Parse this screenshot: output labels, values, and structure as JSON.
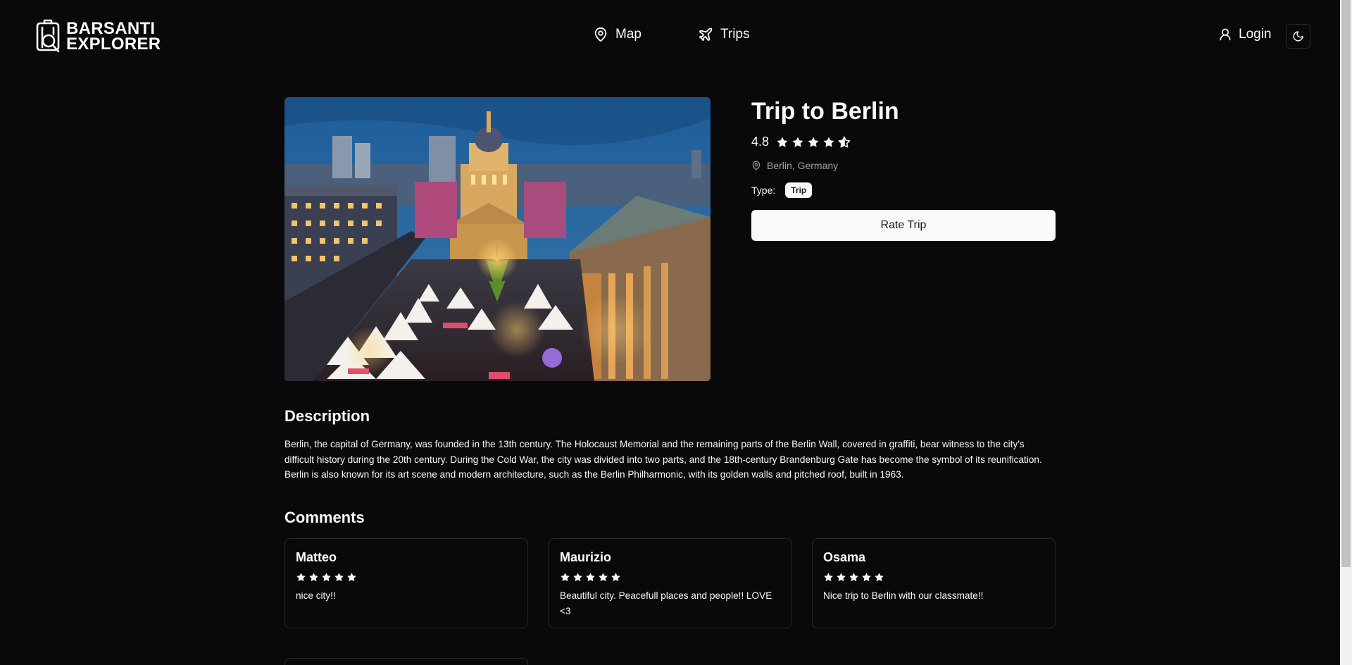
{
  "header": {
    "logo_line1": "BARSANTI",
    "logo_line2": "EXPLORER",
    "nav": [
      {
        "label": "Map",
        "icon": "map-pin-icon"
      },
      {
        "label": "Trips",
        "icon": "plane-icon"
      }
    ],
    "login_label": "Login",
    "theme_icon": "moon-icon"
  },
  "trip": {
    "title": "Trip to Berlin",
    "rating": "4.8",
    "rating_value": 4.8,
    "location": "Berlin, Germany",
    "type_label": "Type:",
    "type_value": "Trip",
    "rate_button": "Rate Trip",
    "image_alt": "Berlin Christmas market at Gendarmenmarkt"
  },
  "description": {
    "heading": "Description",
    "text": "Berlin, the capital of Germany, was founded in the 13th century. The Holocaust Memorial and the remaining parts of the Berlin Wall, covered in graffiti, bear witness to the city's difficult history during the 20th century. During the Cold War, the city was divided into two parts, and the 18th-century Brandenburg Gate has become the symbol of its reunification. Berlin is also known for its art scene and modern architecture, such as the Berlin Philharmonic, with its golden walls and pitched roof, built in 1963."
  },
  "comments": {
    "heading": "Comments",
    "items": [
      {
        "name": "Matteo",
        "stars": 5,
        "text": "nice city!!"
      },
      {
        "name": "Maurizio",
        "stars": 5,
        "text": "Beautiful city. Peacefull places and people!! LOVE <3"
      },
      {
        "name": "Osama",
        "stars": 5,
        "text": "Nice trip to Berlin with our classmate!!"
      }
    ]
  },
  "colors": {
    "background": "#09090b",
    "foreground": "#fafafa",
    "muted": "#a1a1aa",
    "border": "#27272a"
  }
}
